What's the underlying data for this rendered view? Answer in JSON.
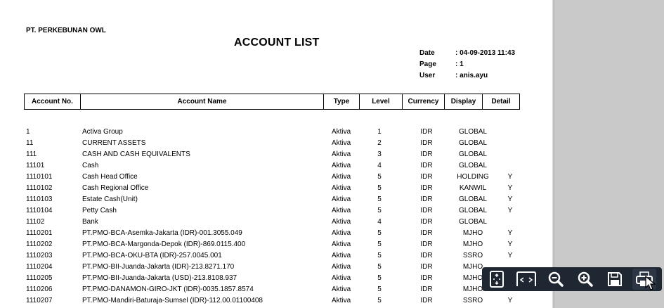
{
  "report": {
    "company": "PT. PERKEBUNAN OWL",
    "title": "ACCOUNT LIST",
    "meta": [
      {
        "label": "Date",
        "value": ": 04-09-2013 11:43"
      },
      {
        "label": "Page",
        "value": ":  1"
      },
      {
        "label": "User",
        "value": ":  anis.ayu"
      }
    ]
  },
  "table": {
    "columns": [
      "Account No.",
      "Account Name",
      "Type",
      "Level",
      "Currency",
      "Display",
      "Detail"
    ],
    "rows": [
      {
        "no": "1",
        "name": "Activa Group",
        "type": "Aktiva",
        "level": "1",
        "currency": "IDR",
        "display": "GLOBAL",
        "detail": ""
      },
      {
        "no": "11",
        "name": "CURRENT ASSETS",
        "type": "Aktiva",
        "level": "2",
        "currency": "IDR",
        "display": "GLOBAL",
        "detail": ""
      },
      {
        "no": "111",
        "name": "CASH AND CASH EQUIVALENTS",
        "type": "Aktiva",
        "level": "3",
        "currency": "IDR",
        "display": "GLOBAL",
        "detail": ""
      },
      {
        "no": "11101",
        "name": "Cash",
        "type": "Aktiva",
        "level": "4",
        "currency": "IDR",
        "display": "GLOBAL",
        "detail": ""
      },
      {
        "no": "1110101",
        "name": "Cash Head Office",
        "type": "Aktiva",
        "level": "5",
        "currency": "IDR",
        "display": "HOLDING",
        "detail": "Y"
      },
      {
        "no": "1110102",
        "name": "Cash Regional Office",
        "type": "Aktiva",
        "level": "5",
        "currency": "IDR",
        "display": "KANWIL",
        "detail": "Y"
      },
      {
        "no": "1110103",
        "name": "Estate Cash(Unit)",
        "type": "Aktiva",
        "level": "5",
        "currency": "IDR",
        "display": "GLOBAL",
        "detail": "Y"
      },
      {
        "no": "1110104",
        "name": "Petty Cash",
        "type": "Aktiva",
        "level": "5",
        "currency": "IDR",
        "display": "GLOBAL",
        "detail": "Y"
      },
      {
        "no": "11102",
        "name": "Bank",
        "type": "Aktiva",
        "level": "4",
        "currency": "IDR",
        "display": "GLOBAL",
        "detail": ""
      },
      {
        "no": "1110201",
        "name": "PT.PMO-BCA-Asemka-Jakarta (IDR)-001.3055.049",
        "type": "Aktiva",
        "level": "5",
        "currency": "IDR",
        "display": "MJHO",
        "detail": "Y"
      },
      {
        "no": "1110202",
        "name": "PT.PMO-BCA-Margonda-Depok (IDR)-869.0115.400",
        "type": "Aktiva",
        "level": "5",
        "currency": "IDR",
        "display": "MJHO",
        "detail": "Y"
      },
      {
        "no": "1110203",
        "name": "PT.PMO-BCA-OKU-BTA (IDR)-257.0045.001",
        "type": "Aktiva",
        "level": "5",
        "currency": "IDR",
        "display": "SSRO",
        "detail": "Y"
      },
      {
        "no": "1110204",
        "name": "PT.PMO-BII-Juanda-Jakarta (IDR)-213.8271.170",
        "type": "Aktiva",
        "level": "5",
        "currency": "IDR",
        "display": "MJHO",
        "detail": ""
      },
      {
        "no": "1110205",
        "name": "PT.PMO-BII-Juanda-Jakarta (USD)-213.8108.937",
        "type": "Aktiva",
        "level": "5",
        "currency": "IDR",
        "display": "MJHO",
        "detail": ""
      },
      {
        "no": "1110206",
        "name": "PT.PMO-DANAMON-GIRO-JKT (IDR)-0035.1857.8574",
        "type": "Aktiva",
        "level": "5",
        "currency": "IDR",
        "display": "MJHO",
        "detail": ""
      },
      {
        "no": "1110207",
        "name": "PT.PMO-Mandiri-Baturaja-Sumsel (IDR)-112.00.01100408",
        "type": "Aktiva",
        "level": "5",
        "currency": "IDR",
        "display": "SSRO",
        "detail": "Y"
      }
    ]
  },
  "toolbar": {
    "buttons": [
      {
        "icon": "fit-page-icon"
      },
      {
        "icon": "fit-width-icon"
      },
      {
        "icon": "zoom-out-icon"
      },
      {
        "icon": "zoom-in-icon"
      },
      {
        "icon": "save-icon"
      },
      {
        "icon": "print-icon"
      }
    ]
  },
  "colors": {
    "toolbar_bg": "#1f2733",
    "sidebar_bg": "#c9c9c9",
    "icon_color": "#ffffff"
  }
}
